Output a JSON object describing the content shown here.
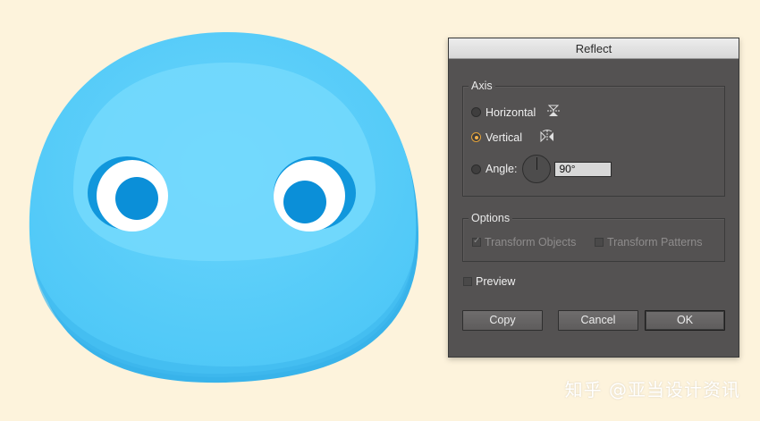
{
  "dialog": {
    "title": "Reflect",
    "axis": {
      "group_label": "Axis",
      "horizontal_label": "Horizontal",
      "vertical_label": "Vertical",
      "angle_label": "Angle:",
      "angle_value": "90°",
      "selected": "Vertical"
    },
    "options": {
      "group_label": "Options",
      "transform_objects_label": "Transform Objects",
      "transform_patterns_label": "Transform Patterns"
    },
    "preview_label": "Preview",
    "buttons": {
      "copy": "Copy",
      "cancel": "Cancel",
      "ok": "OK"
    }
  },
  "watermark": "知乎 @亚当设计资讯",
  "colors": {
    "background": "#fdf3dc",
    "blob_body": "#5ccdfa",
    "blob_shade": "#3fb6ec",
    "eye_iris": "#0b8fd8",
    "dialog_bg": "#545252",
    "radio_accent": "#f2b14c"
  }
}
